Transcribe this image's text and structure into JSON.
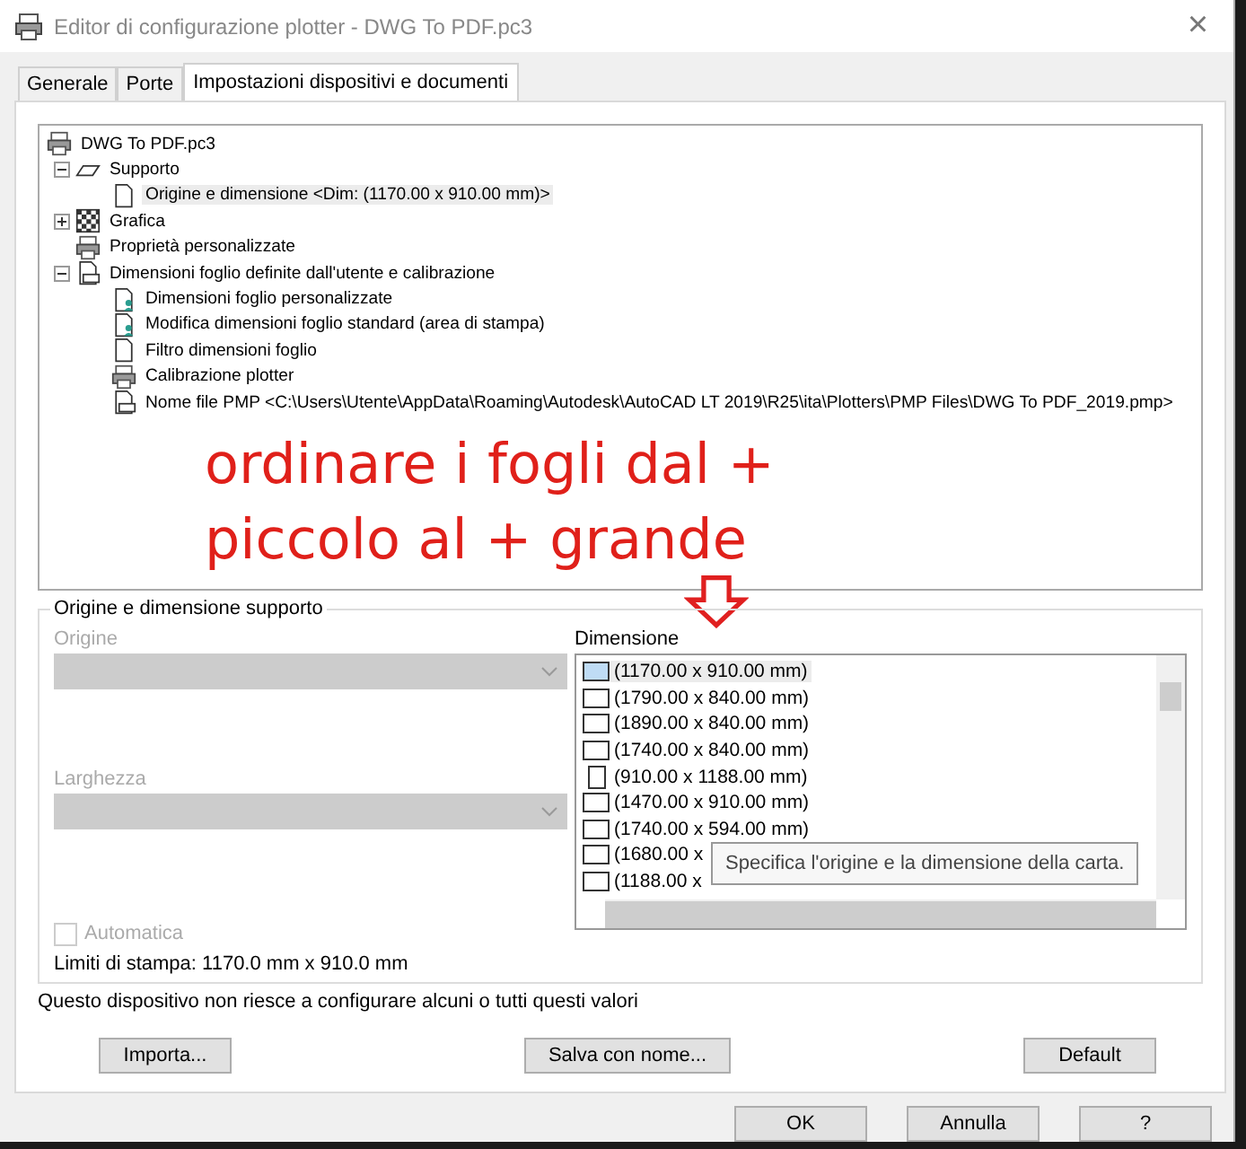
{
  "window": {
    "title": "Editor di configurazione plotter - DWG To PDF.pc3",
    "close": "×"
  },
  "tabs": [
    {
      "label": "Generale",
      "selected": false
    },
    {
      "label": "Porte",
      "selected": false
    },
    {
      "label": "Impostazioni dispositivi e documenti",
      "selected": true
    }
  ],
  "tree": {
    "label": "DWG To PDF.pc3",
    "children": [
      {
        "label": "Supporto",
        "kind": "media",
        "expanded": true,
        "selected": false,
        "children": [
          {
            "label": "Origine e dimensione <Dim: (1170.00 x 910.00 mm)>",
            "kind": "page",
            "selected": true
          }
        ]
      },
      {
        "label": "Grafica",
        "kind": "graphics",
        "expanded": false,
        "selected": false
      },
      {
        "label": "Proprietà personalizzate",
        "kind": "printer",
        "selected": false
      },
      {
        "label": "Dimensioni foglio definite dall'utente e calibrazione",
        "kind": "pageprinter",
        "expanded": true,
        "selected": false,
        "children": [
          {
            "label": "Dimensioni foglio personalizzate",
            "kind": "pageuser",
            "selected": false
          },
          {
            "label": "Modifica dimensioni foglio standard (area di stampa)",
            "kind": "pageuser",
            "selected": false
          },
          {
            "label": "Filtro dimensioni foglio",
            "kind": "page",
            "selected": false
          },
          {
            "label": "Calibrazione plotter",
            "kind": "printer",
            "selected": false
          },
          {
            "label": "Nome file PMP <C:\\Users\\Utente\\AppData\\Roaming\\Autodesk\\AutoCAD LT 2019\\R25\\ita\\Plotters\\PMP Files\\DWG To PDF_2019.pmp>",
            "kind": "pageprinter",
            "selected": false
          }
        ]
      }
    ]
  },
  "annotation": {
    "lines": [
      "ordinare i fogli dal +",
      "piccolo al + grande"
    ]
  },
  "group": {
    "title": "Origine e dimensione supporto",
    "origin": {
      "label": "Origine",
      "disabled": true
    },
    "width": {
      "label": "Larghezza",
      "disabled": true
    },
    "automatic": {
      "label": "Automatica",
      "checked": false,
      "disabled": true
    },
    "limits": "Limiti di stampa: 1170.0 mm x 910.0 mm",
    "size_label": "Dimensione",
    "sizes": [
      {
        "label": "(1170.00 x 910.00 mm)",
        "kind": "landscape",
        "selected": true
      },
      {
        "label": "(1790.00 x 840.00 mm)",
        "kind": "landscape",
        "selected": false
      },
      {
        "label": "(1890.00 x 840.00 mm)",
        "kind": "landscape",
        "selected": false
      },
      {
        "label": "(1740.00 x 840.00 mm)",
        "kind": "landscape",
        "selected": false
      },
      {
        "label": "(910.00 x 1188.00 mm)",
        "kind": "portrait",
        "selected": false
      },
      {
        "label": "(1470.00 x 910.00 mm)",
        "kind": "landscape",
        "selected": false
      },
      {
        "label": "(1740.00 x 594.00 mm)",
        "kind": "landscape",
        "selected": false
      },
      {
        "label": "(1680.00 x",
        "kind": "landscape",
        "selected": false
      },
      {
        "label": "(1188.00 x",
        "kind": "landscape",
        "selected": false
      }
    ],
    "tooltip": "Specifica l'origine e la dimensione della carta."
  },
  "note": "Questo dispositivo non riesce a configurare alcuni o tutti questi valori",
  "panel_buttons": [
    "Importa...",
    "Salva con nome...",
    "Default"
  ],
  "dialog_buttons": [
    "OK",
    "Annulla",
    "?"
  ]
}
